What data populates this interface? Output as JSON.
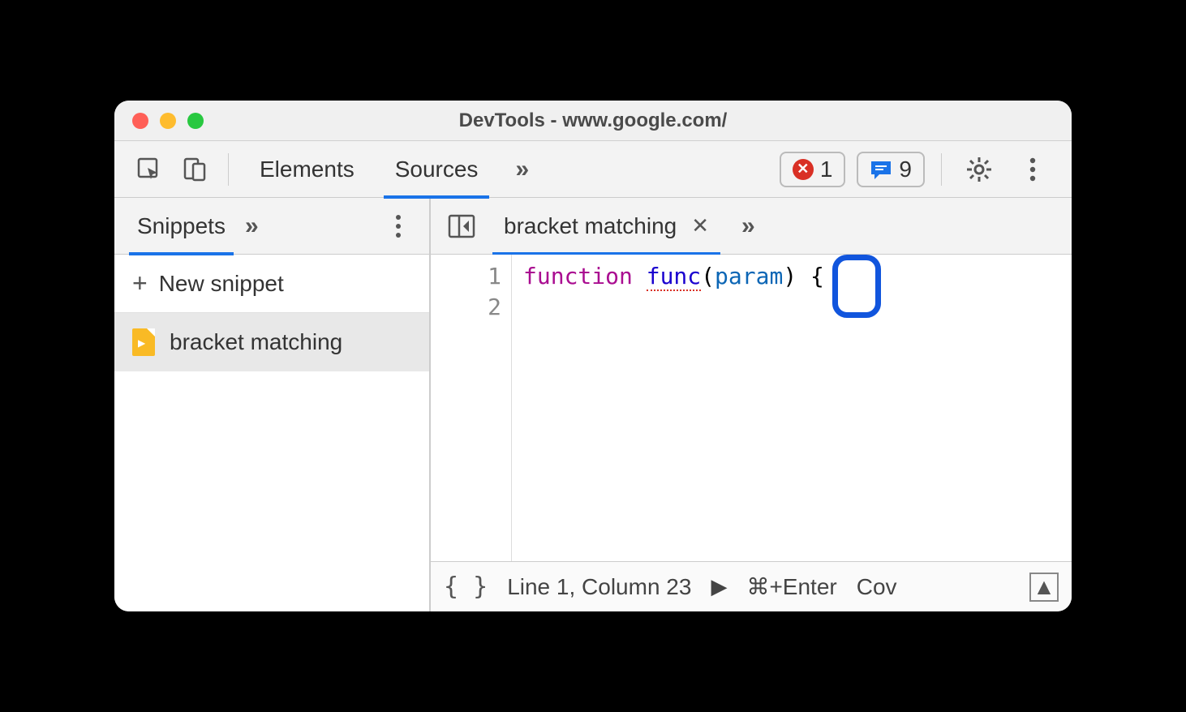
{
  "window": {
    "title": "DevTools - www.google.com/"
  },
  "toolbar": {
    "tabs": [
      "Elements",
      "Sources"
    ],
    "activeTab": "Sources",
    "overflow": "»",
    "errors": {
      "count": "1"
    },
    "messages": {
      "count": "9"
    }
  },
  "sidebar": {
    "tab": "Snippets",
    "overflow": "»",
    "newSnippetLabel": "New snippet",
    "items": [
      {
        "name": "bracket matching"
      }
    ]
  },
  "editor": {
    "fileTab": "bracket matching",
    "overflow": "»",
    "lineNumbers": [
      "1",
      "2"
    ],
    "code": {
      "keyword": "function",
      "funcName": "func",
      "openParen": "(",
      "param": "param",
      "closeParen": ")",
      "space": " ",
      "brace": "{"
    }
  },
  "statusbar": {
    "braces": "{ }",
    "cursor": "Line 1, Column 23",
    "play": "▶",
    "shortcut": "⌘+Enter",
    "coverage": "Cov",
    "drawer": "▲"
  }
}
